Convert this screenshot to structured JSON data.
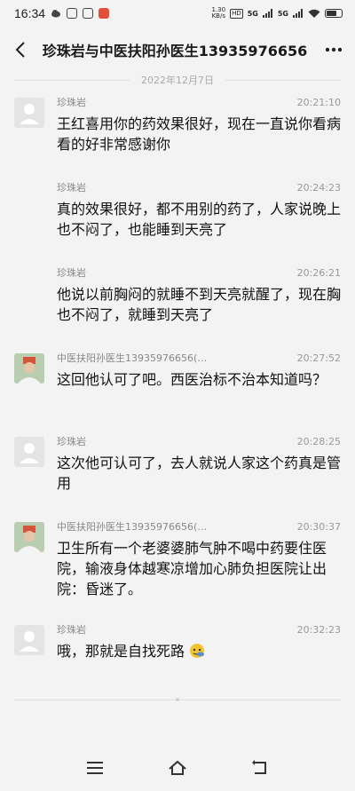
{
  "status_bar": {
    "time": "16:34",
    "speed_value": "1.30",
    "speed_unit": "KB/s",
    "hd": "HD",
    "signal1": "5G",
    "signal2": "5G"
  },
  "header": {
    "title": "珍珠岩与中医扶阳孙医生13935976656"
  },
  "date_divider": "2022年12月7日",
  "messages": [
    {
      "name": "珍珠岩",
      "time": "20:21:10",
      "text": "王红喜用你的药效果很好，现在一直说你看病看的好非常感谢你",
      "avatar": "placeholder"
    },
    {
      "name": "珍珠岩",
      "time": "20:24:23",
      "text": "真的效果很好，都不用别的药了，人家说晚上也不闷了，也能睡到天亮了",
      "avatar": "none"
    },
    {
      "name": "珍珠岩",
      "time": "20:26:21",
      "text": "他说以前胸闷的就睡不到天亮就醒了，现在胸也不闷了，就睡到天亮了",
      "avatar": "none"
    },
    {
      "name": "中医扶阳孙医生13935976656(…",
      "time": "20:27:52",
      "text": "这回他认可了吧。西医治标不治本知道吗？",
      "avatar": "photo"
    },
    {
      "name": "珍珠岩",
      "time": "20:28:25",
      "text": "这次他可认可了，去人就说人家这个药真是管用",
      "avatar": "placeholder"
    },
    {
      "name": "中医扶阳孙医生13935976656(…",
      "time": "20:30:37",
      "text": "卫生所有一个老婆婆肺气肿不喝中药要住医院，输液身体越寒凉增加心肺负担医院让出院：昏迷了。",
      "avatar": "photo"
    },
    {
      "name": "珍珠岩",
      "time": "20:32:23",
      "text": "哦，那就是自找死路",
      "avatar": "placeholder",
      "emoji": "face-emoji"
    }
  ],
  "icons": {
    "back": "back-arrow-icon",
    "more": "more-dots-icon",
    "nav_menu": "menu-icon",
    "nav_home": "home-icon",
    "nav_back": "back-icon"
  }
}
